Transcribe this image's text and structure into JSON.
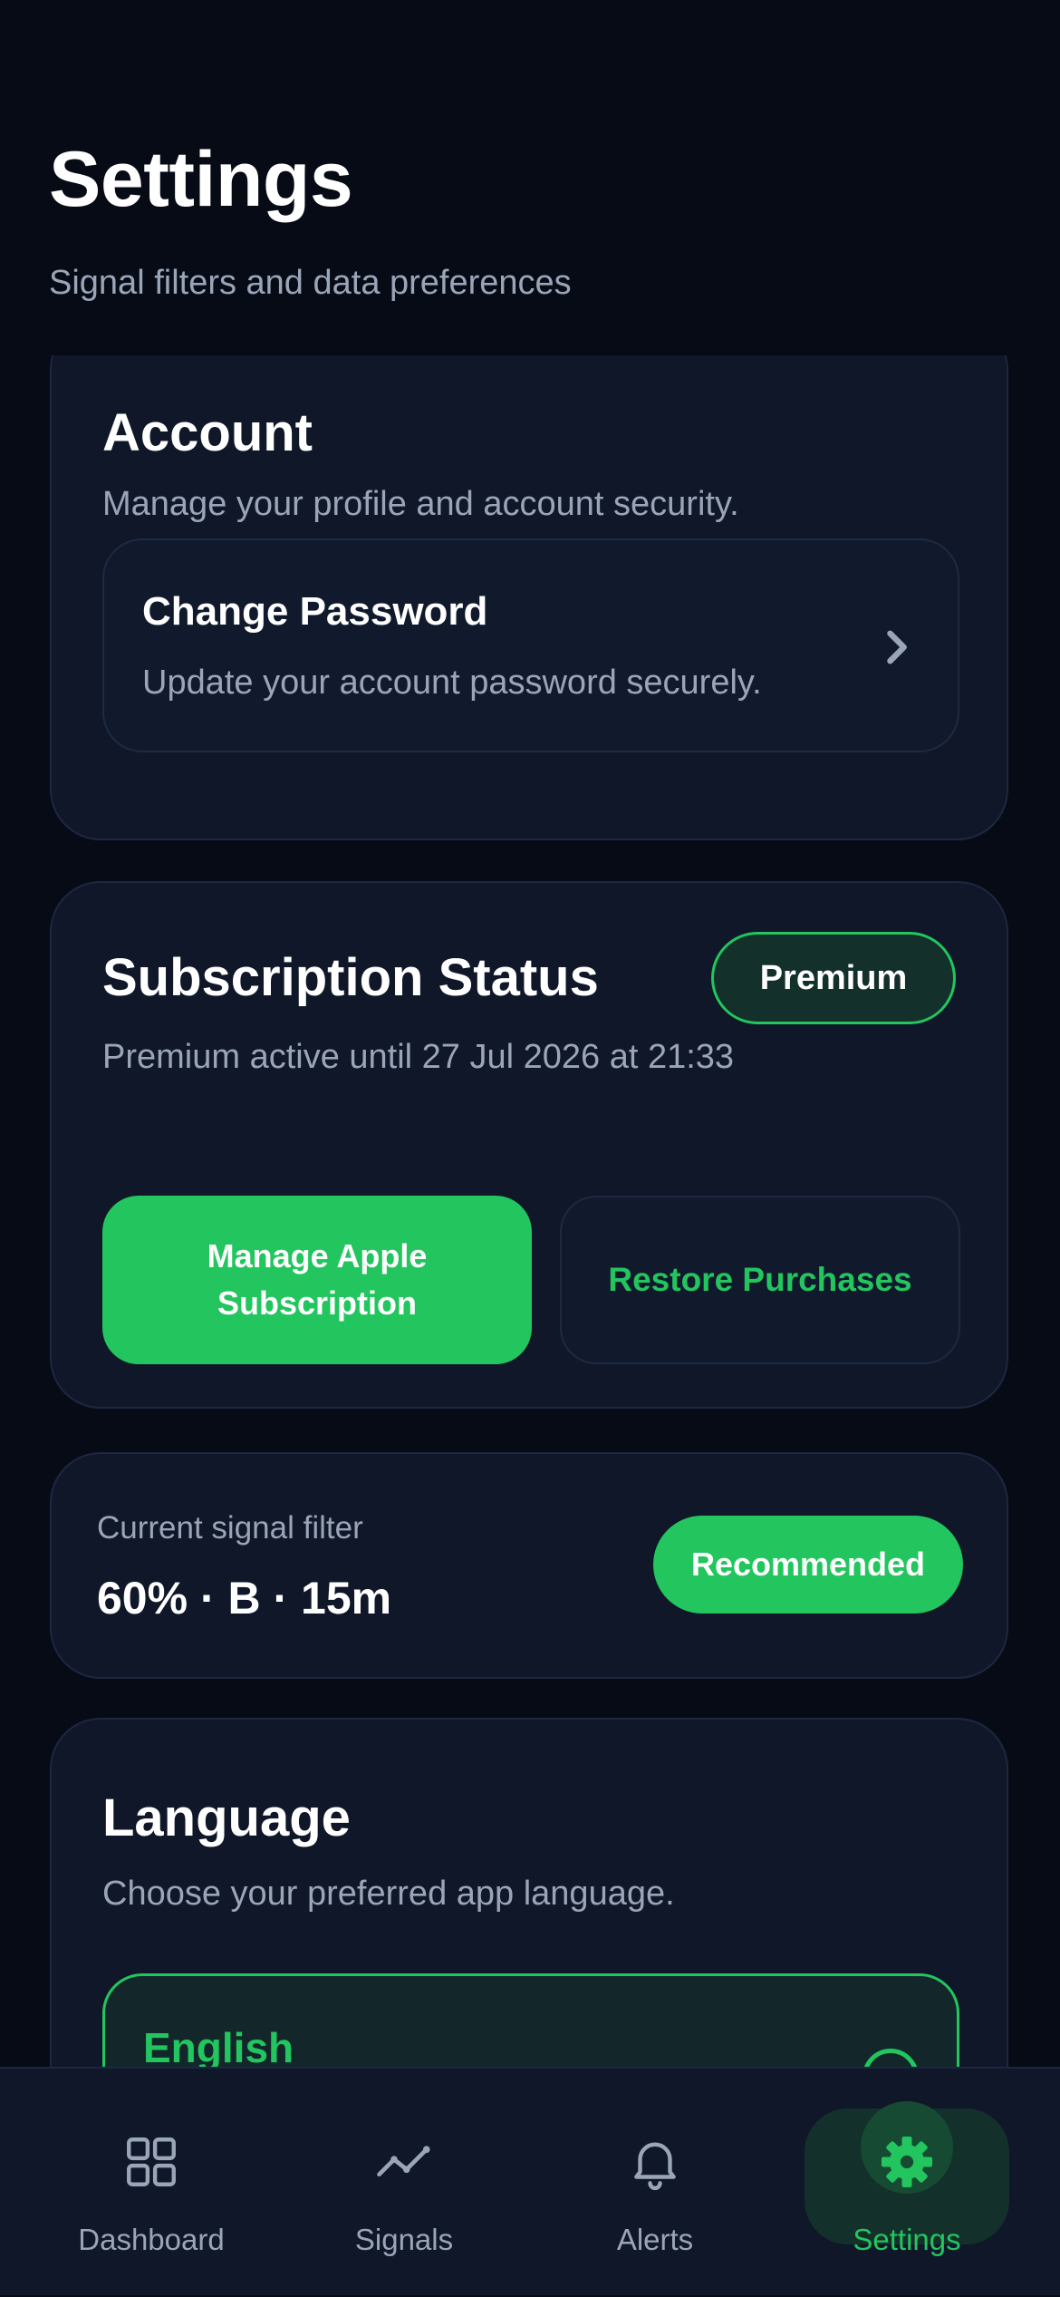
{
  "header": {
    "title": "Settings",
    "subtitle": "Signal filters and data preferences"
  },
  "account": {
    "title": "Account",
    "description": "Manage your profile and account security.",
    "change_password": {
      "title": "Change Password",
      "description": "Update your account password securely."
    }
  },
  "subscription": {
    "title": "Subscription Status",
    "badge": "Premium",
    "status_text": "Premium active until 27 Jul 2026 at 21:33",
    "manage_button": "Manage Apple Subscription",
    "restore_button": "Restore Purchases"
  },
  "signal_filter": {
    "label": "Current signal filter",
    "value": "60% · B · 15m",
    "badge": "Recommended"
  },
  "language": {
    "title": "Language",
    "description": "Choose your preferred app language.",
    "selected_option": "English"
  },
  "tabbar": {
    "tabs": [
      {
        "label": "Dashboard",
        "icon": "dashboard-icon"
      },
      {
        "label": "Signals",
        "icon": "signals-icon"
      },
      {
        "label": "Alerts",
        "icon": "bell-icon"
      },
      {
        "label": "Settings",
        "icon": "gear-icon"
      }
    ],
    "active": "Settings"
  },
  "colors": {
    "background": "#060b16",
    "card": "#0f1729",
    "accent": "#22c55e",
    "muted_text": "#9aa5b8"
  }
}
